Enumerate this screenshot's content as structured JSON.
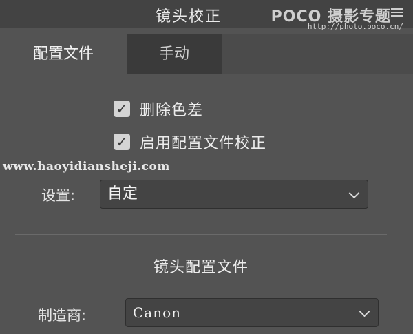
{
  "panel": {
    "title": "镜头校正",
    "watermark_brand": "POCO 摄影专题",
    "watermark_url": "http://photo.poco.cn/"
  },
  "tabs": [
    {
      "label": "配置文件",
      "active": true
    },
    {
      "label": "手动",
      "active": false
    }
  ],
  "checks": [
    {
      "label": "删除色差",
      "checked": true,
      "mark": "✓"
    },
    {
      "label": "启用配置文件校正",
      "checked": true,
      "mark": "✓"
    }
  ],
  "site_watermark": "www.haoyidiansheji.com",
  "settings": {
    "label": "设置:",
    "value": "自定"
  },
  "lens_profile": {
    "title": "镜头配置文件",
    "maker_label": "制造商:",
    "maker_value": "Canon"
  },
  "colors": {
    "panel_bg": "#535353",
    "titlebar_bg": "#434343",
    "inactive_tab_bg": "#3a3a3a",
    "checkbox_fill": "#d4d4d4"
  },
  "icons": {
    "panel_menu": "hamburger-menu-icon",
    "dropdown": "chevron-down-icon",
    "check": "checkmark-icon"
  }
}
